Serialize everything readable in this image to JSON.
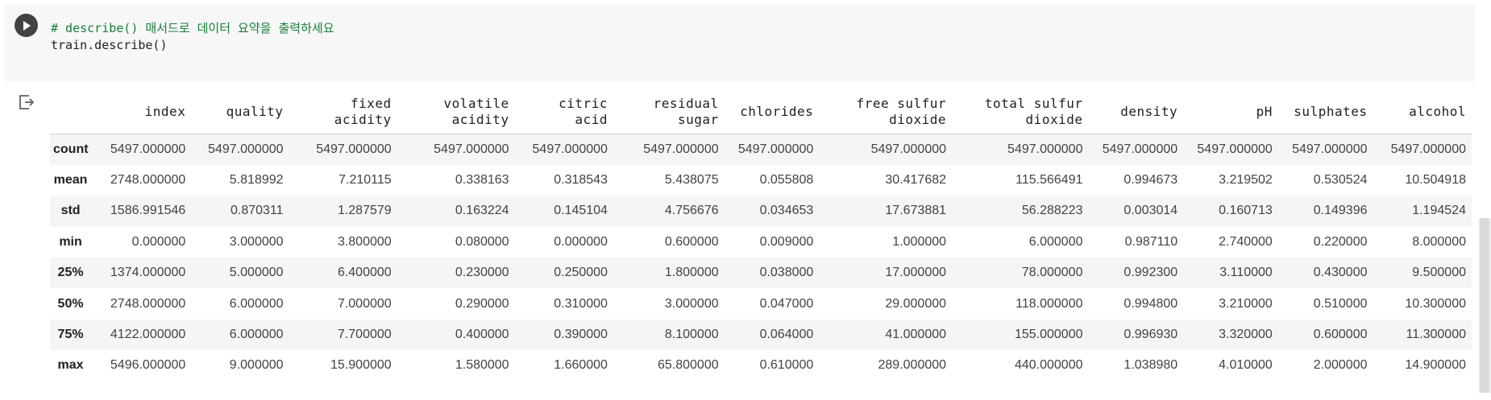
{
  "cell": {
    "code_comment": "# describe() 매서드로 데이터 요약을 출력하세요",
    "code_line": "train.describe()"
  },
  "icons": {
    "run": "play-circle-icon",
    "output": "output-redirect-icon"
  },
  "table": {
    "columns": [
      {
        "line1": "index",
        "line2": ""
      },
      {
        "line1": "quality",
        "line2": ""
      },
      {
        "line1": "fixed",
        "line2": "acidity"
      },
      {
        "line1": "volatile",
        "line2": "acidity"
      },
      {
        "line1": "citric",
        "line2": "acid"
      },
      {
        "line1": "residual",
        "line2": "sugar"
      },
      {
        "line1": "chlorides",
        "line2": ""
      },
      {
        "line1": "free sulfur",
        "line2": "dioxide"
      },
      {
        "line1": "total sulfur",
        "line2": "dioxide"
      },
      {
        "line1": "density",
        "line2": ""
      },
      {
        "line1": "pH",
        "line2": ""
      },
      {
        "line1": "sulphates",
        "line2": ""
      },
      {
        "line1": "alcohol",
        "line2": ""
      }
    ],
    "rows": [
      {
        "label": "count",
        "values": [
          "5497.000000",
          "5497.000000",
          "5497.000000",
          "5497.000000",
          "5497.000000",
          "5497.000000",
          "5497.000000",
          "5497.000000",
          "5497.000000",
          "5497.000000",
          "5497.000000",
          "5497.000000",
          "5497.000000"
        ]
      },
      {
        "label": "mean",
        "values": [
          "2748.000000",
          "5.818992",
          "7.210115",
          "0.338163",
          "0.318543",
          "5.438075",
          "0.055808",
          "30.417682",
          "115.566491",
          "0.994673",
          "3.219502",
          "0.530524",
          "10.504918"
        ]
      },
      {
        "label": "std",
        "values": [
          "1586.991546",
          "0.870311",
          "1.287579",
          "0.163224",
          "0.145104",
          "4.756676",
          "0.034653",
          "17.673881",
          "56.288223",
          "0.003014",
          "0.160713",
          "0.149396",
          "1.194524"
        ]
      },
      {
        "label": "min",
        "values": [
          "0.000000",
          "3.000000",
          "3.800000",
          "0.080000",
          "0.000000",
          "0.600000",
          "0.009000",
          "1.000000",
          "6.000000",
          "0.987110",
          "2.740000",
          "0.220000",
          "8.000000"
        ]
      },
      {
        "label": "25%",
        "values": [
          "1374.000000",
          "5.000000",
          "6.400000",
          "0.230000",
          "0.250000",
          "1.800000",
          "0.038000",
          "17.000000",
          "78.000000",
          "0.992300",
          "3.110000",
          "0.430000",
          "9.500000"
        ]
      },
      {
        "label": "50%",
        "values": [
          "2748.000000",
          "6.000000",
          "7.000000",
          "0.290000",
          "0.310000",
          "3.000000",
          "0.047000",
          "29.000000",
          "118.000000",
          "0.994800",
          "3.210000",
          "0.510000",
          "10.300000"
        ]
      },
      {
        "label": "75%",
        "values": [
          "4122.000000",
          "6.000000",
          "7.700000",
          "0.400000",
          "0.390000",
          "8.100000",
          "0.064000",
          "41.000000",
          "155.000000",
          "0.996930",
          "3.320000",
          "0.600000",
          "11.300000"
        ]
      },
      {
        "label": "max",
        "values": [
          "5496.000000",
          "9.000000",
          "15.900000",
          "1.580000",
          "1.660000",
          "65.800000",
          "0.610000",
          "289.000000",
          "440.000000",
          "1.038980",
          "4.010000",
          "2.000000",
          "14.900000"
        ]
      }
    ]
  }
}
